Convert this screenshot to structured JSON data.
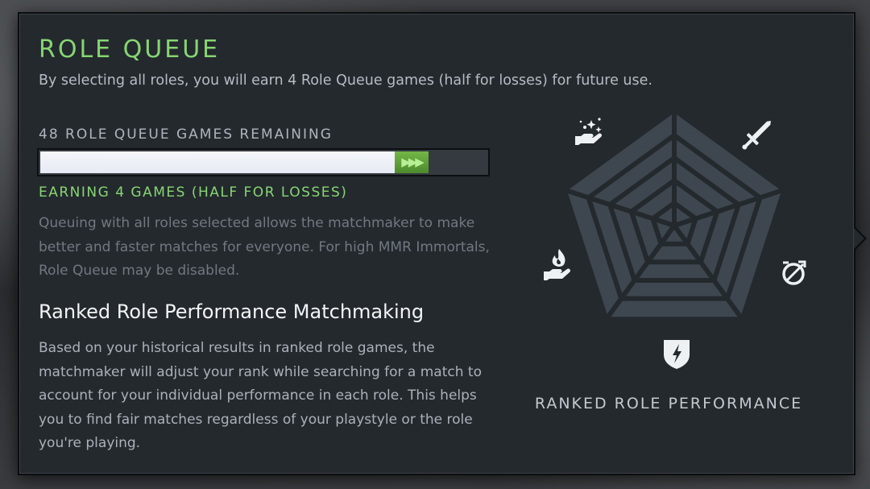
{
  "role_queue": {
    "title": "ROLE QUEUE",
    "subtitle": "By selecting all roles, you will earn 4 Role Queue games (half for losses) for future use.",
    "games_remaining_label": "48 ROLE QUEUE GAMES REMAINING",
    "progress": {
      "current_fraction": 0.795,
      "earning_fraction": 0.075,
      "earning_glyph": "▶▶▶"
    },
    "earning_label": "EARNING 4 GAMES (HALF FOR LOSSES)",
    "description": "Queuing with all roles selected allows the matchmaker to make better and faster matches for everyone. For high MMR Immortals, Role Queue may be disabled."
  },
  "ranked_performance": {
    "heading": "Ranked Role Performance Matchmaking",
    "body": "Based on your historical results in ranked role games, the matchmaker will adjust your rank while searching for a match to account for your individual performance in each role. This helps you to find fair matches regardless of your playstyle or the role you're playing.",
    "chart_label": "RANKED ROLE PERFORMANCE",
    "role_icons": [
      "sparkle-hand-icon",
      "sword-icon",
      "target-icon",
      "shield-bolt-icon",
      "flame-hand-icon"
    ],
    "colors": {
      "web": "#3e474f",
      "web_lines": "#24292e",
      "icons": "#eef1f3"
    }
  },
  "colors": {
    "accent_green": "#86d672",
    "panel_bg": "#24292e",
    "progress_fill": "#e6eaf2",
    "progress_earn": "#5e9e38"
  }
}
